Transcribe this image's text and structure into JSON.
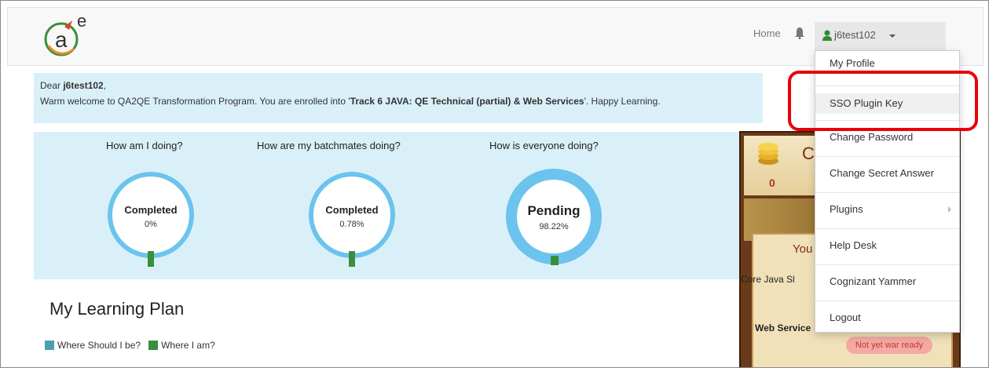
{
  "nav": {
    "home": "Home",
    "user": "j6test102",
    "brand_color": "#f8f8f8"
  },
  "welcome": {
    "dear": "Dear ",
    "name": "j6test102",
    "comma": ",",
    "line2_pre": "Warm welcome to QA2QE Transformation Program. You are enrolled into '",
    "track": "Track 6 JAVA: QE Technical (partial) & Web Services",
    "line2_post": "'. Happy Learning."
  },
  "stats": [
    {
      "title": "How am I doing?",
      "status": "Completed",
      "value": "0%",
      "progress": 0
    },
    {
      "title": "How are my batchmates doing?",
      "status": "Completed",
      "value": "0.78%",
      "progress": 0.0078
    },
    {
      "title": "How is everyone doing?",
      "status": "Pending",
      "value": "98.22%",
      "progress": 0.9822
    }
  ],
  "learning_plan": {
    "title": "My Learning Plan",
    "legend": [
      {
        "label": "Where Should I be?",
        "color": "#4a9fb5"
      },
      {
        "label": "Where I am?",
        "color": "#3a8f3a"
      }
    ]
  },
  "game": {
    "coins": "0",
    "heading_partial": "C",
    "you_partial": "You",
    "row1": "Core Java Sl",
    "row2": "Web Service",
    "badge": "Not yet war ready"
  },
  "dropdown": {
    "items": [
      "My Profile",
      "SSO Plugin Key",
      "Change Password",
      "Change Secret Answer",
      "Plugins",
      "Help Desk",
      "Cognizant Yammer",
      "Logout"
    ]
  },
  "colors": {
    "annotation": "#e8000b",
    "gauge": "#6cc3ee",
    "panel": "#daf0f8"
  }
}
